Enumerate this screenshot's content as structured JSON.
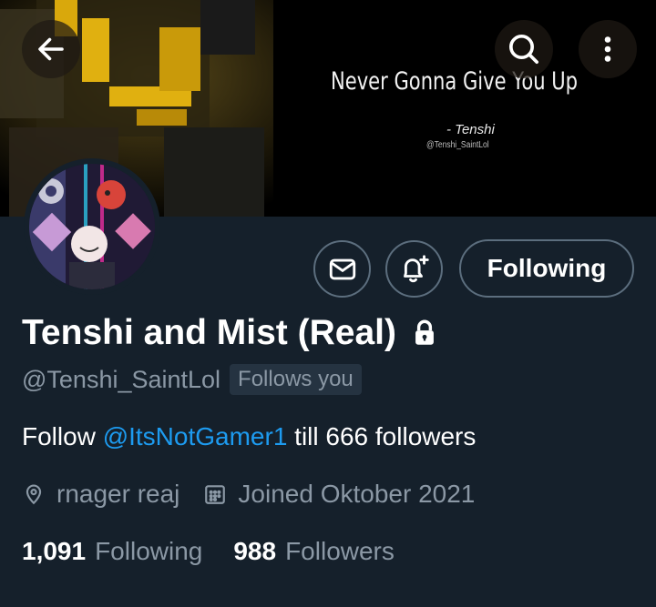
{
  "banner": {
    "quote": "Never Gonna Give You Up",
    "author": "- Tenshi",
    "handle": "@Tenshi_SaintLol"
  },
  "icons": {
    "back": "arrow-left-icon",
    "search": "search-icon",
    "more": "more-vertical-icon",
    "message": "mail-icon",
    "notify": "bell-plus-icon",
    "protected": "lock-icon",
    "location": "location-pin-icon",
    "joined": "calendar-icon"
  },
  "actions": {
    "following_label": "Following"
  },
  "profile": {
    "display_name": "Tenshi and Mist (Real)",
    "handle": "@Tenshi_SaintLol",
    "follows_you": "Follows you",
    "bio_prefix": "Follow ",
    "bio_mention": "@ItsNotGamer1",
    "bio_suffix": " till 666 followers",
    "location": "rnager reaj",
    "joined": "Joined Oktober 2021"
  },
  "stats": {
    "following_count": "1,091",
    "following_label": "Following",
    "followers_count": "988",
    "followers_label": "Followers"
  },
  "colors": {
    "background": "#15202b",
    "accent": "#1d9bf0",
    "secondary_text": "#8b98a5",
    "border": "#5c6e7e",
    "badge_bg": "#253341"
  }
}
